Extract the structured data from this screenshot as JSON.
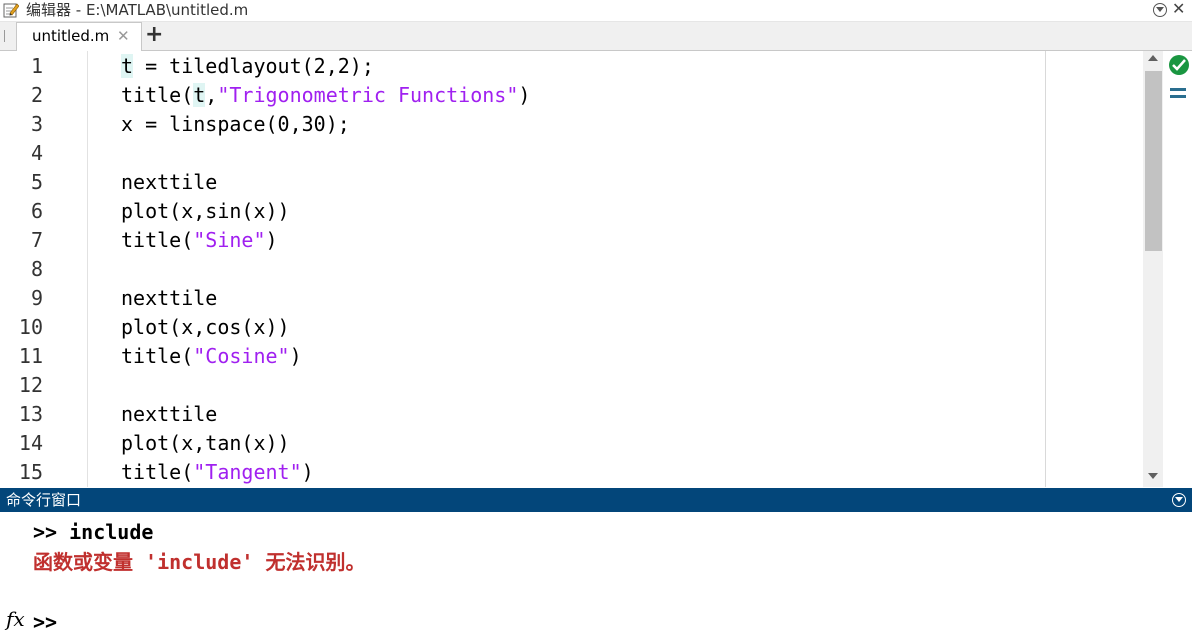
{
  "window": {
    "title": "编辑器 - E:\\MATLAB\\untitled.m",
    "close_glyph": "✕"
  },
  "tabs": [
    {
      "label": "untitled.m",
      "close_glyph": "✕"
    }
  ],
  "tab_add_glyph": "+",
  "editor": {
    "lines": [
      {
        "n": "1",
        "text": "t = tiledlayout(2,2);"
      },
      {
        "n": "2",
        "text": "title(t,\"Trigonometric Functions\")"
      },
      {
        "n": "3",
        "text": "x = linspace(0,30);"
      },
      {
        "n": "4",
        "text": ""
      },
      {
        "n": "5",
        "text": "nexttile"
      },
      {
        "n": "6",
        "text": "plot(x,sin(x))"
      },
      {
        "n": "7",
        "text": "title(\"Sine\")"
      },
      {
        "n": "8",
        "text": ""
      },
      {
        "n": "9",
        "text": "nexttile"
      },
      {
        "n": "10",
        "text": "plot(x,cos(x))"
      },
      {
        "n": "11",
        "text": "title(\"Cosine\")"
      },
      {
        "n": "12",
        "text": ""
      },
      {
        "n": "13",
        "text": "nexttile"
      },
      {
        "n": "14",
        "text": "plot(x,tan(x))"
      },
      {
        "n": "15",
        "text": "title(\"Tangent\")"
      }
    ],
    "string_color": "#a020f0",
    "highlight_color": "#dff5f3",
    "status": "check-icon"
  },
  "command_window": {
    "title": "命令行窗口",
    "header_color": "#03467a",
    "history": ">> include",
    "error": "函数或变量 'include' 无法识别。",
    "error_color": "#c0302e",
    "prompt": ">>",
    "fx_label": "fx"
  }
}
